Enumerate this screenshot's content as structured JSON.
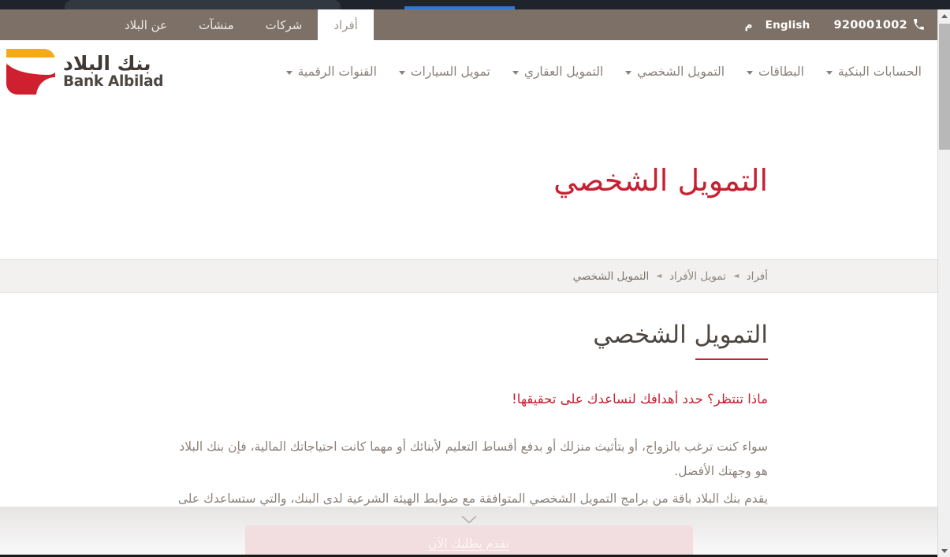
{
  "browser": {
    "chrome_label": ""
  },
  "utility_bar": {
    "cut_item_text": "م",
    "language_label": "English",
    "phone_number": "920001002",
    "phone_icon": "phone-icon",
    "sections": [
      {
        "label": "أفراد",
        "active": true
      },
      {
        "label": "شركات",
        "active": false
      },
      {
        "label": "منشآت",
        "active": false
      },
      {
        "label": "عن البلاد",
        "active": false
      }
    ]
  },
  "header": {
    "logo": {
      "arabic": "بنك البلاد",
      "english": "Bank Albilad",
      "orange_hex": "#f5aa1c",
      "red_hex": "#cf2030"
    },
    "nav_items": [
      {
        "label": "الحسابات البنكية",
        "has_caret": true
      },
      {
        "label": "البطاقات",
        "has_caret": true
      },
      {
        "label": "التمويل الشخصي",
        "has_caret": true
      },
      {
        "label": "التمويل العقاري",
        "has_caret": true
      },
      {
        "label": "تمويل السيارات",
        "has_caret": true
      },
      {
        "label": "القنوات الرقمية",
        "has_caret": true
      }
    ]
  },
  "hero": {
    "title": "التمويل الشخصي",
    "title_color": "#c62133"
  },
  "breadcrumb": {
    "separator": "◄",
    "items": [
      {
        "label": "أفراد",
        "current": false
      },
      {
        "label": "تمويل الأفراد",
        "current": false
      },
      {
        "label": "التمويل الشخصي",
        "current": true
      }
    ]
  },
  "main": {
    "section_title": "التمويل الشخصي",
    "section_title_color": "#4e4741",
    "accent_color": "#c62133",
    "lead": "ماذا تنتظر؟ حدد أهدافك لنساعدك على تحقيقها!",
    "paragraph_line_1": "سواء كنت ترغب بالزواج، أو بتأثيث منزلك أو بدفع أقساط التعليم لأبنائك أو مهما كانت احتياجاتك المالية، فإن بنك البلاد هو وجهتك الأفضل.",
    "paragraph_line_2": "يقدم بنك البلاد باقة من برامج التمويل الشخصي المتوافقة مع ضوابط الهيئة الشرعية لدى البنك، والتي ستساعدك على تحقيق أهدافك."
  },
  "bottom": {
    "chevron_icon": "chevron-down-icon",
    "cta_label": "تقدم بطلبك الآن",
    "cta_bg": "#f2dde0"
  },
  "scrollbar": {
    "up_icon": "scroll-up-arrow-icon",
    "down_icon": "scroll-down-arrow-icon"
  }
}
